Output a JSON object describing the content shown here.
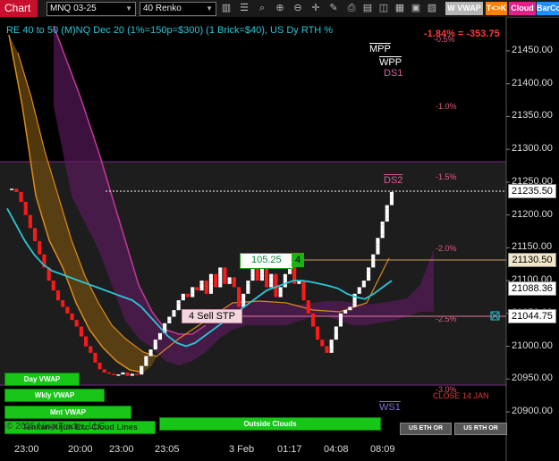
{
  "toolbar": {
    "chart_tab": "Chart",
    "instrument": "MNQ 03-25",
    "bar_type": "40 Renko",
    "vwap_btn": "W VWAP",
    "tk_btn": "T<>K",
    "cloud_btn": "Cloud",
    "barco_btn": "BarCo",
    "colors": {
      "tab": "#c8102e",
      "tk": "#ff7f00",
      "cloud": "#e0218a",
      "barco": "#1e90ff"
    }
  },
  "header": {
    "title": "RE 40 to 50 (M)NQ Dec 20 (1%=150p=$300) (1 Brick=$40), US Dy RTH %",
    "pnl_text": "-1.84% = -353.75",
    "pnl_color": "#ff3b3b"
  },
  "levels": {
    "mpp": "MPP",
    "wpp": "WPP",
    "ds1": "DS1",
    "ds2": "DS2",
    "ws1": "WS1",
    "close_label": "CLOSE 14 JAN",
    "pct_labels": [
      "-0.5%",
      "-1.0%",
      "-1.5%",
      "-2.0%",
      "-2.5%",
      "-3.0%"
    ]
  },
  "orders": {
    "target_price": "105.25",
    "target_qty": "4",
    "stop_label": "4 Sell STP"
  },
  "price_labels": {
    "current": "21235.50",
    "target": "21130.50",
    "vwap": "21088.36",
    "stop": "21044.75"
  },
  "buttons": {
    "day_vwap": "Day VWAP",
    "wkly_vwap": "Wkly VWAP",
    "mnt_vwap": "Mnt VWAP",
    "outside_clouds": "Outside Clouds",
    "tenkan": "Tenkan-Kijun Exc Cloud Lines",
    "us_eth": "US ETH OR",
    "us_rth": "US RTH OR"
  },
  "footer": {
    "copyright": "© 2025 NinjaTrader, LLC"
  },
  "chart_data": {
    "type": "renko",
    "title": "RE 40 to 50 (M)NQ Dec 20 (1%=150p=$300) (1 Brick=$40), US Dy RTH %",
    "brick_size": 5.25,
    "y_ticks": [
      21450,
      21400,
      21350,
      21300,
      21250,
      21200,
      21150,
      21100,
      21050,
      21000,
      20950,
      20900
    ],
    "y_tick_labels": [
      "21450.00",
      "21400.00",
      "21350.00",
      "21300.00",
      "21250.00",
      "21200.00",
      "21150.00",
      "21100.00",
      "21050.00",
      "21000.00",
      "20950.00",
      "20900.00"
    ],
    "ylim": [
      20870,
      21485
    ],
    "x_labels": [
      "23:00",
      "20:00",
      "23:00",
      "23:05",
      "3 Feb",
      "01:17",
      "04:08",
      "08:09"
    ],
    "price_path": [
      21240,
      21240,
      21235,
      21220,
      21200,
      21180,
      21160,
      21140,
      21120,
      21100,
      21085,
      21070,
      21060,
      21050,
      21040,
      21030,
      21015,
      21000,
      20990,
      20975,
      20965,
      20960,
      20958,
      20956,
      20957,
      20960,
      20955,
      20958,
      20957,
      20970,
      20985,
      20995,
      21010,
      21020,
      21035,
      21045,
      21055,
      21070,
      21080,
      21075,
      21090,
      21085,
      21100,
      21080,
      21110,
      21090,
      21120,
      21095,
      21105,
      21090,
      21060,
      21080,
      21100,
      21130,
      21100,
      21120,
      21090,
      21110,
      21075,
      21090,
      21110,
      21125,
      21095,
      21100,
      21070,
      21050,
      21030,
      21010,
      21000,
      20990,
      21010,
      21030,
      21050,
      21055,
      21060,
      21080,
      21090,
      21100,
      21120,
      21140,
      21165,
      21190,
      21215,
      21235
    ],
    "vwap_path": [
      21210,
      21185,
      21160,
      21140,
      21125,
      21115,
      21110,
      21105,
      21100,
      21095,
      21090,
      21085,
      21080,
      21075,
      21070,
      21060,
      21045,
      21030,
      21015,
      21005,
      21000,
      21005,
      21015,
      21025,
      21035,
      21045,
      21055,
      21065,
      21075,
      21085,
      21090,
      21095,
      21100,
      21100,
      21098,
      21095,
      21092,
      21088,
      21080,
      21075,
      21072,
      21080,
      21090,
      21100
    ],
    "key_levels": {
      "current": 21235.5,
      "target": 21130.5,
      "vwap": 21088.36,
      "stop": 21044.75,
      "ds2": 21235.5
    }
  }
}
